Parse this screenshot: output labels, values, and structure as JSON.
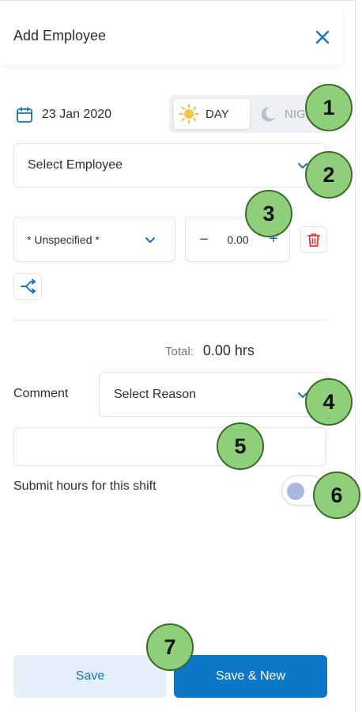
{
  "dialog": {
    "title": "Add Employee",
    "close_icon": "close-icon"
  },
  "shift": {
    "date": "23 Jan 2020",
    "day_label": "DAY",
    "night_label": "NIGHT",
    "selected": "DAY"
  },
  "employee_select": {
    "value": "Select Employee"
  },
  "role_select": {
    "value": "* Unspecified *"
  },
  "hours_stepper": {
    "minus": "−",
    "value": "0.00",
    "plus": "+"
  },
  "total": {
    "label": "Total:",
    "value": "0.00 hrs"
  },
  "comment": {
    "label": "Comment",
    "reason_placeholder": "Select Reason",
    "input_value": ""
  },
  "submit": {
    "label": "Submit hours for this shift",
    "enabled": false
  },
  "footer": {
    "save_label": "Save",
    "save_new_label": "Save & New"
  },
  "annotations": [
    "1",
    "2",
    "3",
    "4",
    "5",
    "6",
    "7"
  ],
  "colors": {
    "accent": "#0a77c9",
    "link_blue": "#1b6fc2",
    "danger": "#e0393e",
    "badge_green": "#8fcf7a"
  }
}
